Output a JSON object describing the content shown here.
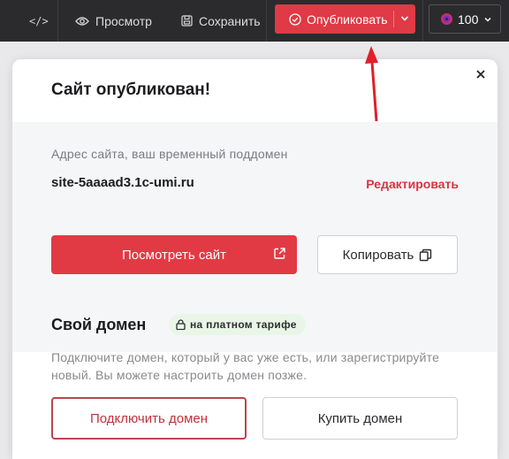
{
  "toolbar": {
    "code_label": "</>",
    "preview_label": "Просмотр",
    "save_label": "Сохранить",
    "publish_label": "Опубликовать",
    "zoom_value": "100"
  },
  "modal": {
    "title": "Сайт опубликован!",
    "address_label": "Адрес сайта, ваш временный поддомен",
    "domain": "site-5aaaad3.1c-umi.ru",
    "edit_label": "Редактировать",
    "view_site_label": "Посмотреть сайт",
    "copy_label": "Копировать",
    "own_domain_title": "Свой домен",
    "paid_badge": "на платном тарифе",
    "own_domain_desc": "Подключите домен, который у вас уже есть, или зарегистрируйте новый. Вы можете настроить домен позже.",
    "connect_label": "Подключить домен",
    "buy_label": "Купить домен"
  },
  "colors": {
    "accent": "#e23a45",
    "toolbar_bg": "#2b2b2d",
    "annotation_arrow": "#e0202a"
  }
}
